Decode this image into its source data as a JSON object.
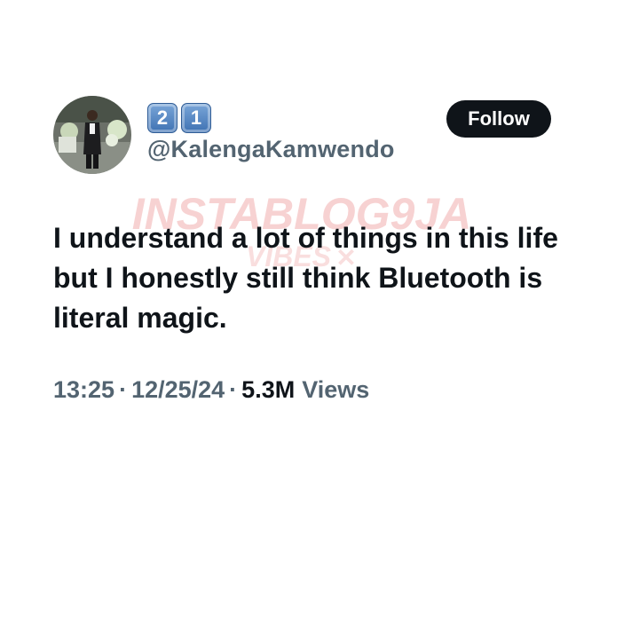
{
  "user": {
    "display_name": [
      "2",
      "1"
    ],
    "handle": "@KalengaKamwendo"
  },
  "follow_button": {
    "label": "Follow"
  },
  "tweet": {
    "text": "I understand a lot of things in this life but I honestly still think Bluetooth is literal magic."
  },
  "meta": {
    "time": "13:25",
    "separator": "·",
    "date": "12/25/24",
    "views_count": "5.3M",
    "views_label": "Views"
  },
  "watermark": {
    "line1": "INSTABLOG9JA",
    "line2": "VIBES"
  },
  "colors": {
    "text_primary": "#0f1419",
    "text_secondary": "#536471",
    "button_bg": "#0f1419",
    "button_text": "#ffffff",
    "keycap_blue": "#3f72b3",
    "watermark": "#f5c6c6"
  }
}
